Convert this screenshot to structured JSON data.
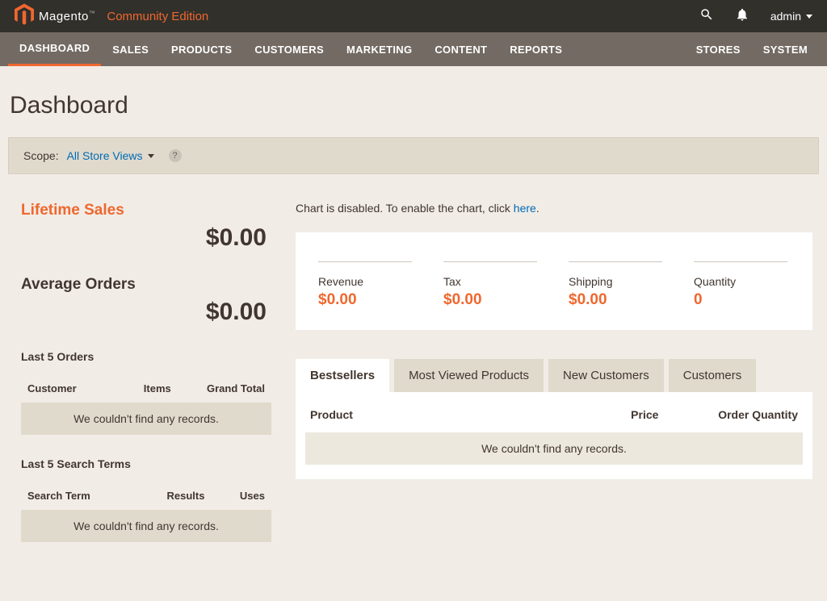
{
  "header": {
    "logo_text": "Magento",
    "edition": "Community Edition",
    "user": "admin"
  },
  "nav": {
    "left": [
      "DASHBOARD",
      "SALES",
      "PRODUCTS",
      "CUSTOMERS",
      "MARKETING",
      "CONTENT",
      "REPORTS"
    ],
    "right": [
      "STORES",
      "SYSTEM"
    ],
    "active_index": 0
  },
  "page": {
    "title": "Dashboard"
  },
  "scope": {
    "label": "Scope:",
    "value": "All Store Views",
    "help": "?"
  },
  "stats": {
    "lifetime_sales_label": "Lifetime Sales",
    "lifetime_sales_value": "$0.00",
    "average_orders_label": "Average Orders",
    "average_orders_value": "$0.00"
  },
  "last_orders": {
    "title": "Last 5 Orders",
    "cols": [
      "Customer",
      "Items",
      "Grand Total"
    ],
    "empty": "We couldn't find any records."
  },
  "last_search": {
    "title": "Last 5 Search Terms",
    "cols": [
      "Search Term",
      "Results",
      "Uses"
    ],
    "empty": "We couldn't find any records."
  },
  "chart_notice": {
    "prefix": "Chart is disabled. To enable the chart, click ",
    "link": "here",
    "suffix": "."
  },
  "summary": {
    "revenue_label": "Revenue",
    "revenue_value": "$0.00",
    "tax_label": "Tax",
    "tax_value": "$0.00",
    "shipping_label": "Shipping",
    "shipping_value": "$0.00",
    "quantity_label": "Quantity",
    "quantity_value": "0"
  },
  "tabs": {
    "items": [
      "Bestsellers",
      "Most Viewed Products",
      "New Customers",
      "Customers"
    ],
    "active_index": 0
  },
  "bestsellers": {
    "cols": [
      "Product",
      "Price",
      "Order Quantity"
    ],
    "empty": "We couldn't find any records."
  }
}
